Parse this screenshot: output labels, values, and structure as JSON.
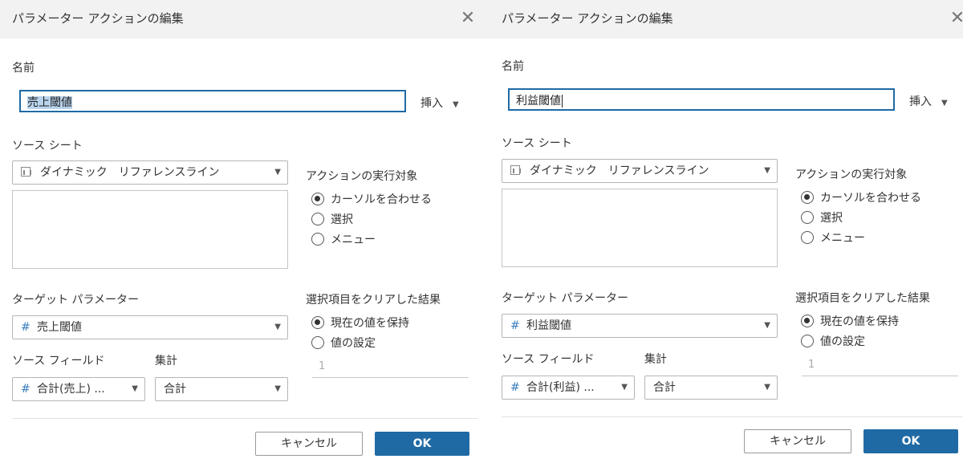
{
  "dialogs": [
    {
      "title": "パラメーター アクションの編集",
      "name_label": "名前",
      "name_value": "売上閾値",
      "insert_label": "挿入",
      "source_sheet_label": "ソース シート",
      "source_sheet_value": "ダイナミック　リファレンスライン",
      "run_on_label": "アクションの実行対象",
      "run_on_options": [
        "カーソルを合わせる",
        "選択",
        "メニュー"
      ],
      "run_on_selected": 0,
      "target_param_label": "ターゲット パラメーター",
      "target_param_value": "売上閾値",
      "clear_label": "選択項目をクリアした結果",
      "clear_options": [
        "現在の値を保持",
        "値の設定"
      ],
      "clear_selected": 0,
      "source_field_label": "ソース フィールド",
      "source_field_value": "合計(売上) ...",
      "agg_label": "集計",
      "agg_value": "合計",
      "value_field": "1",
      "cancel_label": "キャンセル",
      "ok_label": "OK"
    },
    {
      "title": "パラメーター アクションの編集",
      "name_label": "名前",
      "name_value": "利益閾値",
      "insert_label": "挿入",
      "source_sheet_label": "ソース シート",
      "source_sheet_value": "ダイナミック　リファレンスライン",
      "run_on_label": "アクションの実行対象",
      "run_on_options": [
        "カーソルを合わせる",
        "選択",
        "メニュー"
      ],
      "run_on_selected": 0,
      "target_param_label": "ターゲット パラメーター",
      "target_param_value": "利益閾値",
      "clear_label": "選択項目をクリアした結果",
      "clear_options": [
        "現在の値を保持",
        "値の設定"
      ],
      "clear_selected": 0,
      "source_field_label": "ソース フィールド",
      "source_field_value": "合計(利益) ...",
      "agg_label": "集計",
      "agg_value": "合計",
      "value_field": "1",
      "cancel_label": "キャンセル",
      "ok_label": "OK"
    }
  ],
  "colors": {
    "accent": "#1f6aa5",
    "titlebar_bg": "#f2f2f2",
    "selection": "#b8d4ee"
  },
  "icons": {
    "close": "close-icon",
    "sheet": "sheet-icon",
    "parameter": "hash-icon",
    "dropdown": "chevron-down-icon"
  }
}
